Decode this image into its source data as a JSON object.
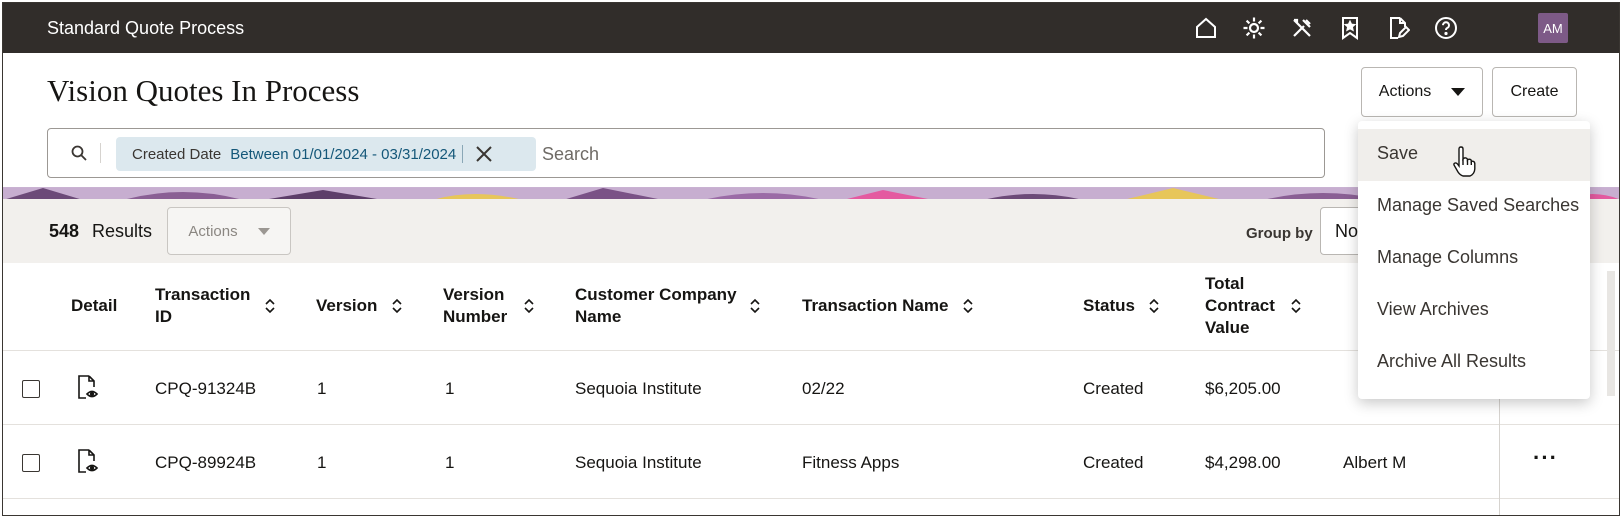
{
  "app": {
    "title": "Standard Quote Process",
    "user_initials": "AM",
    "top_icons": [
      "home-icon",
      "settings-icon",
      "tools-icon",
      "bookmark-icon",
      "edit-document-icon",
      "help-icon"
    ]
  },
  "page": {
    "title": "Vision Quotes In Process",
    "actions_label": "Actions",
    "create_label": "Create"
  },
  "search": {
    "filter_label": "Created Date",
    "filter_value": "Between 01/01/2024 - 03/31/2024",
    "placeholder": "Search"
  },
  "results": {
    "count": "548",
    "label": "Results",
    "actions_label": "Actions",
    "group_by_label": "Group by",
    "group_by_value": "No"
  },
  "table": {
    "columns": [
      {
        "label": "Detail"
      },
      {
        "label": "Transaction ID"
      },
      {
        "label": "Version"
      },
      {
        "label": "Version Number"
      },
      {
        "label": "Customer Company Name"
      },
      {
        "label": "Transaction Name"
      },
      {
        "label": "Status"
      },
      {
        "label": "Total Contract Value"
      }
    ],
    "rows": [
      {
        "id": "CPQ-91324B",
        "version": "1",
        "version_number": "1",
        "company": "Sequoia Institute",
        "name": "02/22",
        "status": "Created",
        "value": "$6,205.00",
        "owner": ""
      },
      {
        "id": "CPQ-89924B",
        "version": "1",
        "version_number": "1",
        "company": "Sequoia Institute",
        "name": "Fitness Apps",
        "status": "Created",
        "value": "$4,298.00",
        "owner": "Albert M"
      }
    ]
  },
  "menu": {
    "items": [
      "Save",
      "Manage Saved Searches",
      "Manage Columns",
      "View Archives",
      "Archive All Results"
    ],
    "hovered": "Save"
  },
  "colors": {
    "topbar": "#312d2a",
    "avatar": "#7d5a87",
    "chip": "#dce8ee",
    "chip_value": "#145779",
    "results_bar": "#f2f0ed"
  }
}
